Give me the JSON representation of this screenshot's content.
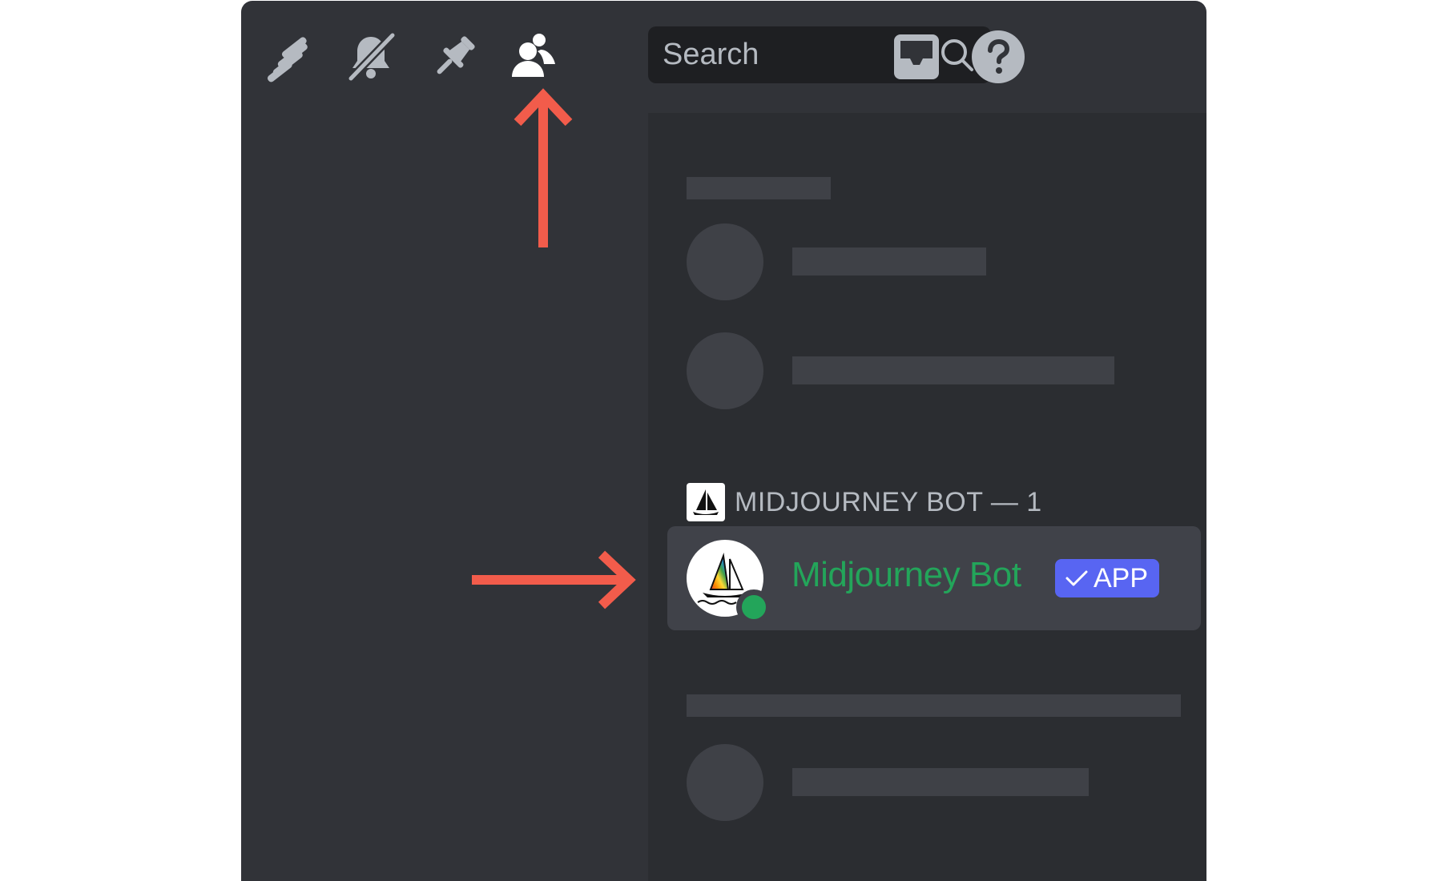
{
  "toolbar": {
    "icons": [
      "threads-icon",
      "bell-slash-icon",
      "pin-icon",
      "members-icon"
    ],
    "search_placeholder": "Search",
    "right_icons": [
      "inbox-icon",
      "help-icon"
    ]
  },
  "member_list": {
    "group_label": "MIDJOURNEY BOT — 1",
    "member": {
      "name": "Midjourney Bot",
      "badge": "APP",
      "status": "online"
    }
  },
  "colors": {
    "background": "#313338",
    "panel": "#2b2d31",
    "skeleton": "#3f4147",
    "online": "#23a55a",
    "badge": "#5865f2",
    "arrow": "#f25c4b"
  }
}
